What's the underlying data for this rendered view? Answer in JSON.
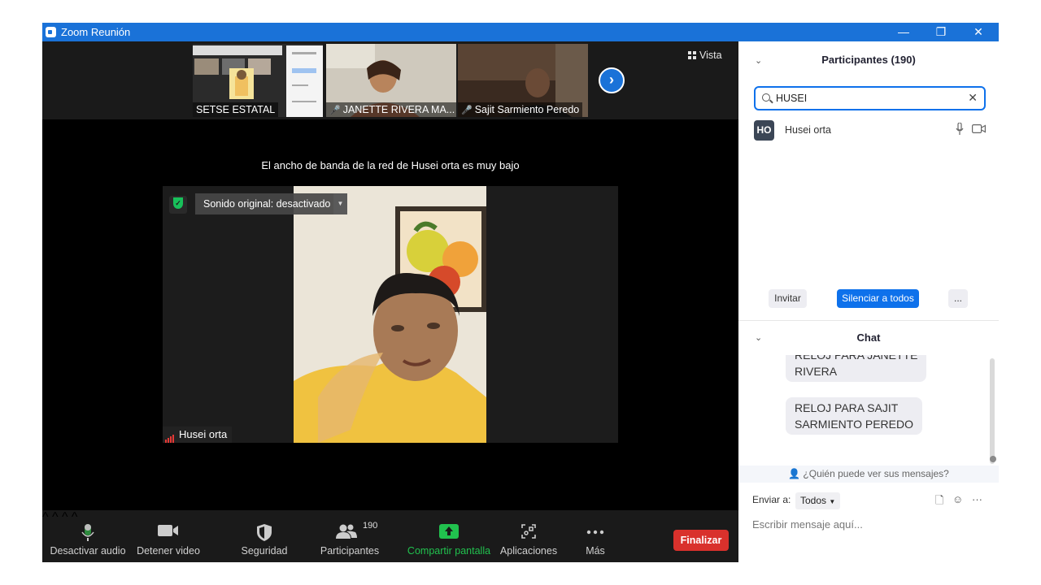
{
  "window": {
    "title": "Zoom Reunión",
    "controls": {
      "minimize": "—",
      "restore": "❐",
      "close": "✕"
    }
  },
  "thumbnails": [
    {
      "name": "SETSE ESTATAL",
      "muted": false
    },
    {
      "name": "JANETTE RIVERA MA...",
      "muted": true
    },
    {
      "name": "Sajit Sarmiento Peredo",
      "muted": true
    }
  ],
  "view_button": "Vista",
  "bandwidth_message": "El ancho de banda de la red de Husei orta es muy bajo",
  "main_video": {
    "sound_badge": "Sonido original: desactivado",
    "participant_name": "Husei orta"
  },
  "toolbar": {
    "audio": "Desactivar audio",
    "video": "Detener video",
    "security": "Seguridad",
    "participants": "Participantes",
    "participants_count": "190",
    "share": "Compartir pantalla",
    "apps": "Aplicaciones",
    "more": "Más",
    "end": "Finalizar"
  },
  "participants_panel": {
    "title": "Participantes (190)",
    "search_value": "HUSEI",
    "results": [
      {
        "initials": "HO",
        "name": "Husei orta"
      }
    ],
    "invite": "Invitar",
    "mute_all": "Silenciar a todos",
    "more": "..."
  },
  "chat_panel": {
    "title": "Chat",
    "messages": [
      {
        "text": "RELOJ PARA JANETTE\nRIVERA"
      },
      {
        "text": "RELOJ PARA SAJIT\nSARMIENTO PEREDO"
      }
    ],
    "who_can_see": "¿Quién puede ver sus mensajes?",
    "send_to_label": "Enviar a:",
    "recipient": "Todos",
    "input_placeholder": "Escribir mensaje aquí..."
  },
  "colors": {
    "accent": "#0e71eb",
    "titlebar": "#1a72d8",
    "end_button": "#d9312c",
    "share_green": "#21c14e"
  }
}
